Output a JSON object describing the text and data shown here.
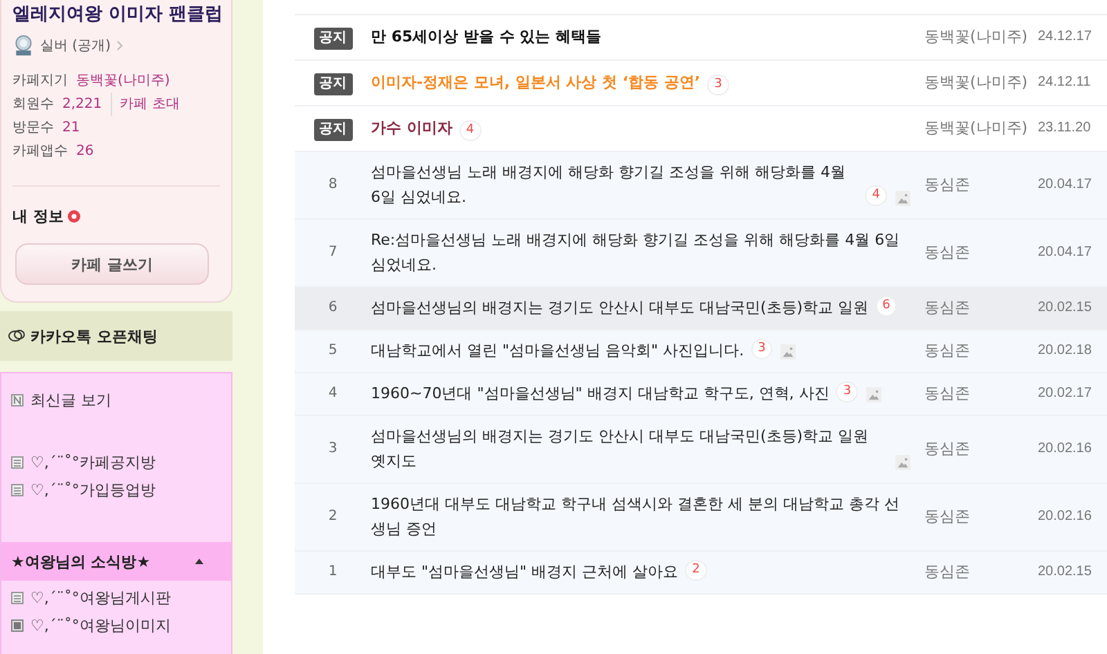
{
  "cafe": {
    "title": "엘레지여왕 이미자 팬클럽",
    "grade": "실버 (공개)",
    "stats": [
      {
        "label": "카페지기",
        "value": "동백꽃(나미주)"
      },
      {
        "label": "회원수",
        "value": "2,221",
        "link": "카페 초대"
      },
      {
        "label": "방문수",
        "value": "21"
      },
      {
        "label": "카페앱수",
        "value": "26"
      }
    ],
    "my_info": "내 정보",
    "write_button": "카페 글쓰기"
  },
  "kakao": {
    "label": "카카오톡 오픈채팅"
  },
  "menu": [
    {
      "kind": "new",
      "label": "최신글 보기"
    },
    {
      "kind": "gap"
    },
    {
      "kind": "board",
      "label": "♡,´¨˚°카페공지방"
    },
    {
      "kind": "board",
      "label": "♡,´¨˚°가입등업방"
    },
    {
      "kind": "gap"
    },
    {
      "kind": "header",
      "label": "★여왕님의 소식방★",
      "expanded": true
    },
    {
      "kind": "board",
      "label": "♡,´¨˚°여왕님게시판"
    },
    {
      "kind": "album",
      "label": "♡,´¨˚°여왕님이미지"
    }
  ],
  "notices": [
    {
      "badge": "공지",
      "title": "만 **65**세이상 받을 수 있는 혜택들",
      "color": "#111111",
      "author": "동백꽃(나미주)",
      "date": "24.12.17"
    },
    {
      "badge": "공지",
      "title": "이미자-정재은 모녀, 일본서 사상 첫 ‘합동 공연’",
      "color": "#f5891f",
      "comments": "3",
      "author": "동백꽃(나미주)",
      "date": "24.12.11"
    },
    {
      "badge": "공지",
      "title": "가수 이미자",
      "color": "#8a2a45",
      "comments": "4",
      "author": "동백꽃(나미주)",
      "date": "23.11.20"
    }
  ],
  "posts": [
    {
      "number": "8",
      "title": "섬마을선생님 노래 배경지에 해당화 향기길 조성을 위해 해당화를 4월 6일 심었네요.",
      "comments": "4",
      "has_image": true,
      "hovered": false,
      "author": "동심존",
      "date": "20.04.17"
    },
    {
      "number": "7",
      "title": "Re:섬마을선생님 노래 배경지에 해당화 향기길 조성을 위해 해당화를 4월 6일 심었네요.",
      "has_image": false,
      "hovered": false,
      "author": "동심존",
      "date": "20.04.17"
    },
    {
      "number": "6",
      "title": "섬마을선생님의 배경지는 경기도 안산시 대부도 대남국민(초등)학교 일원",
      "comments": "6",
      "has_image": false,
      "hovered": true,
      "author": "동심존",
      "date": "20.02.15"
    },
    {
      "number": "5",
      "title": "대남학교에서 열린 \"섬마을선생님 음악회\" 사진입니다.",
      "comments": "3",
      "has_image": true,
      "hovered": false,
      "author": "동심존",
      "date": "20.02.18"
    },
    {
      "number": "4",
      "title": "1960~70년대 \"섬마을선생님\" 배경지 대남학교 학구도, 연혁, 사진",
      "comments": "3",
      "has_image": true,
      "hovered": false,
      "author": "동심존",
      "date": "20.02.17"
    },
    {
      "number": "3",
      "title": "섬마을선생님의 배경지는 경기도 안산시 대부도 대남국민(초등)학교 일원 옛지도",
      "has_image": true,
      "hovered": false,
      "author": "동심존",
      "date": "20.02.16"
    },
    {
      "number": "2",
      "title": "1960년대 대부도 대남학교 학구내 섬색시와 결혼한 세 분의 대남학교 총각 선생님 증언",
      "has_image": false,
      "hovered": false,
      "author": "동심존",
      "date": "20.02.16"
    },
    {
      "number": "1",
      "title": "대부도 \"섬마을선생님\" 배경지 근처에 살아요",
      "comments": "2",
      "has_image": false,
      "hovered": false,
      "author": "동심존",
      "date": "20.02.15"
    }
  ]
}
